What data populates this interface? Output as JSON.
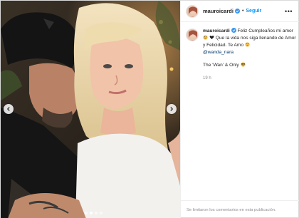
{
  "header": {
    "username": "mauroicardi",
    "separator": "•",
    "follow_label": "Seguir",
    "more_icon": "more-horizontal-icon"
  },
  "caption": {
    "username": "mauroicardi",
    "text_1": "Feliz Cumpleaños mi amor",
    "text_2": "Que la vida nos siga llenando de Amor y Felicidad. Te Amo",
    "mention": "@wanda_nara",
    "text_3": "The 'Wan' & Only",
    "time": "19 h"
  },
  "footer": {
    "comments_disabled": "Se limitaron los comentarios en esta publicación."
  },
  "carousel": {
    "total": 4,
    "active_index": 1
  },
  "colors": {
    "accent": "#0095f6",
    "verified": "#3897f0",
    "mention": "#00376b"
  }
}
